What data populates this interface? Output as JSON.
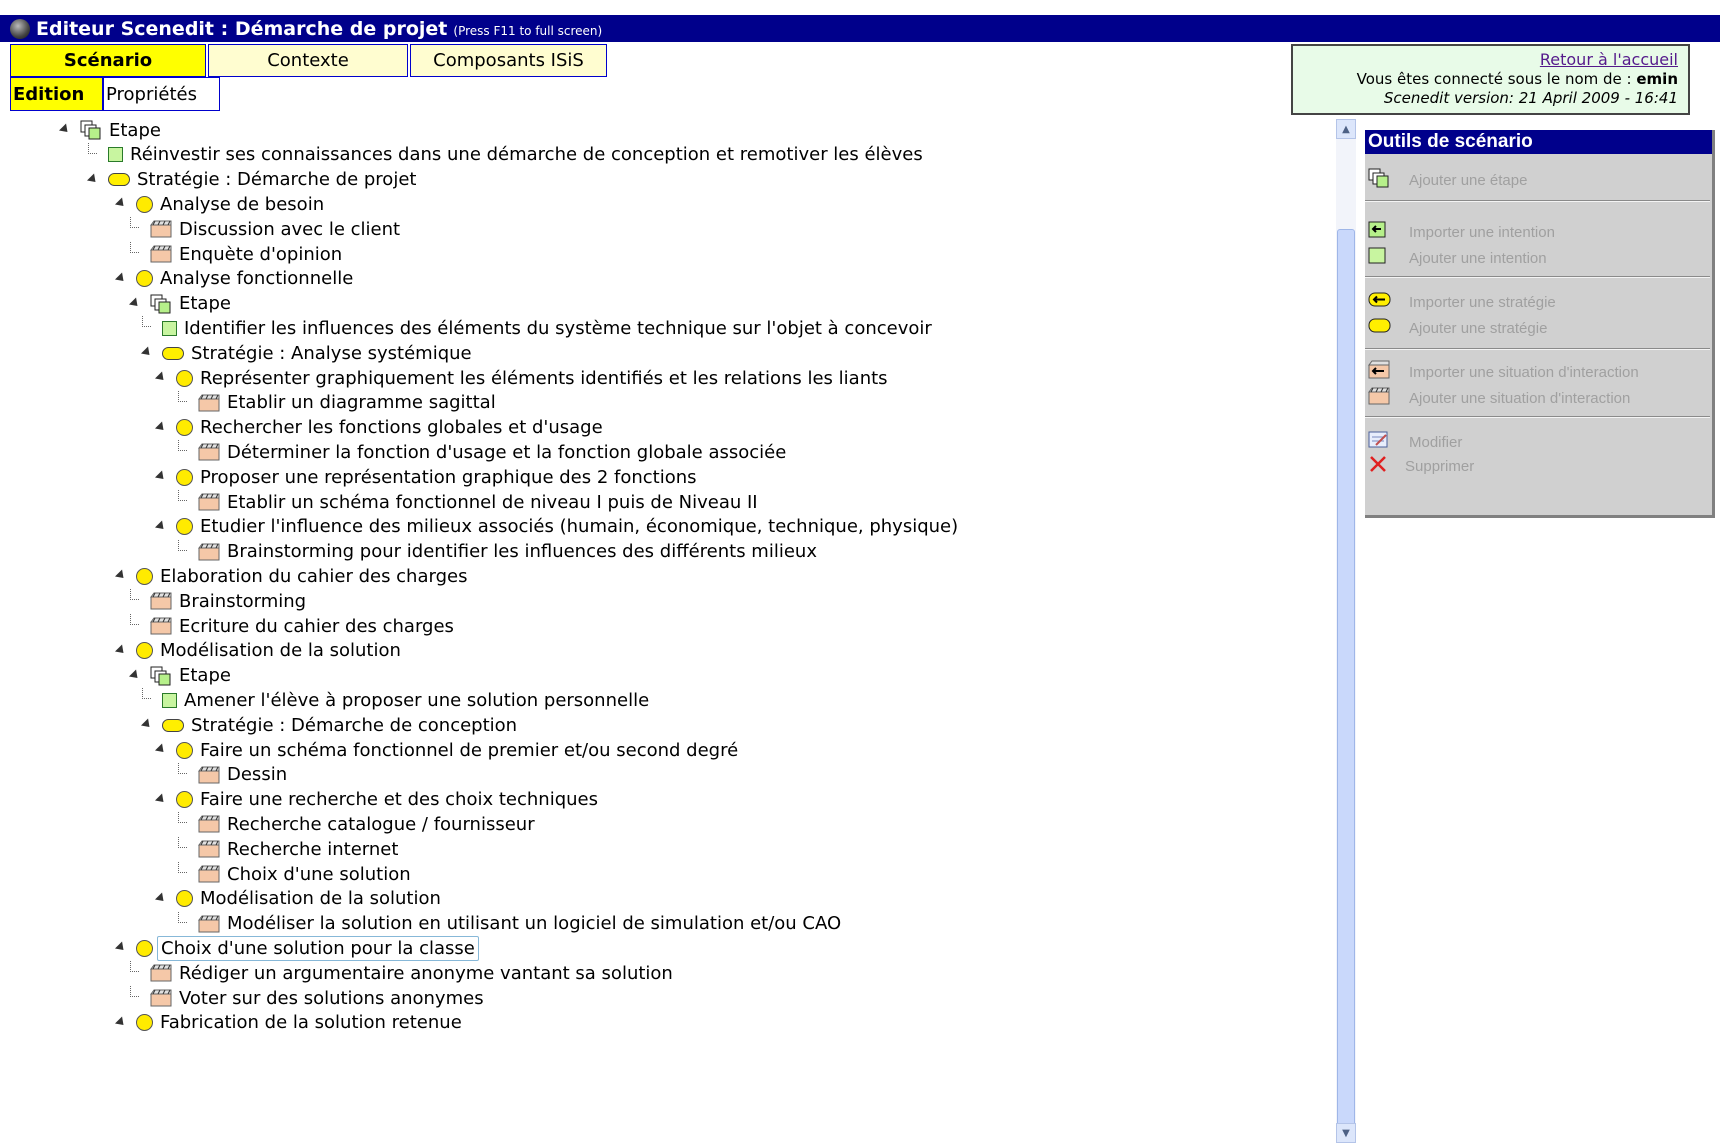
{
  "window": {
    "title": "Editeur Scenedit : Démarche de projet",
    "hint": "(Press F11 to full screen)"
  },
  "tabs": [
    {
      "label": "Scénario",
      "active": true
    },
    {
      "label": "Contexte",
      "active": false
    },
    {
      "label": "Composants ISiS",
      "active": false
    }
  ],
  "subtabs": [
    {
      "label": "Edition",
      "active": true
    },
    {
      "label": "Propriétés",
      "active": false
    }
  ],
  "info": {
    "home_link": "Retour à l'accueil",
    "connected_prefix": "Vous êtes connecté sous le nom de :",
    "username": "emin",
    "version": "Scenedit version: 21 April 2009 - 16:41"
  },
  "tree": [
    {
      "type": "etape",
      "label": "Etape"
    },
    {
      "type": "intention",
      "label": "Réinvestir ses connaissances dans une démarche de conception et remotiver les élèves"
    },
    {
      "type": "strategie",
      "label": "Stratégie : Démarche de projet"
    },
    {
      "type": "activite",
      "label": "Analyse de besoin"
    },
    {
      "type": "situation",
      "label": "Discussion avec le client"
    },
    {
      "type": "situation",
      "label": "Enquète d'opinion"
    },
    {
      "type": "activite",
      "label": "Analyse fonctionnelle"
    },
    {
      "type": "etape",
      "label": "Etape"
    },
    {
      "type": "intention",
      "label": "Identifier les influences des éléments du système technique sur l'objet à concevoir"
    },
    {
      "type": "strategie",
      "label": "Stratégie : Analyse systémique"
    },
    {
      "type": "activite",
      "label": "Représenter graphiquement les éléments identifiés et les relations les liants"
    },
    {
      "type": "situation",
      "label": "Etablir un diagramme sagittal"
    },
    {
      "type": "activite",
      "label": "Rechercher les fonctions globales et d'usage"
    },
    {
      "type": "situation",
      "label": "Déterminer la fonction d'usage et la fonction globale associée"
    },
    {
      "type": "activite",
      "label": "Proposer une représentation graphique des 2 fonctions"
    },
    {
      "type": "situation",
      "label": "Etablir un schéma fonctionnel de niveau I puis de Niveau II"
    },
    {
      "type": "activite",
      "label": "Etudier l'influence des milieux associés (humain, économique, technique, physique)"
    },
    {
      "type": "situation",
      "label": "Brainstorming pour identifier les influences des différents milieux"
    },
    {
      "type": "activite",
      "label": "Elaboration du cahier des charges"
    },
    {
      "type": "situation",
      "label": "Brainstorming"
    },
    {
      "type": "situation",
      "label": "Ecriture du cahier des charges"
    },
    {
      "type": "activite",
      "label": "Modélisation de la solution"
    },
    {
      "type": "etape",
      "label": "Etape"
    },
    {
      "type": "intention",
      "label": "Amener l'élève à proposer une solution personnelle"
    },
    {
      "type": "strategie",
      "label": "Stratégie : Démarche de conception"
    },
    {
      "type": "activite",
      "label": "Faire un schéma fonctionnel de premier et/ou second degré"
    },
    {
      "type": "situation",
      "label": "Dessin"
    },
    {
      "type": "activite",
      "label": "Faire une recherche et des choix techniques"
    },
    {
      "type": "situation",
      "label": "Recherche catalogue / fournisseur"
    },
    {
      "type": "situation",
      "label": "Recherche internet"
    },
    {
      "type": "situation",
      "label": "Choix d'une solution"
    },
    {
      "type": "activite",
      "label": "Modélisation de la solution"
    },
    {
      "type": "situation",
      "label": "Modéliser la solution en utilisant un logiciel de simulation et/ou CAO"
    },
    {
      "type": "activite",
      "label": "Choix d'une solution pour la classe",
      "selected": true
    },
    {
      "type": "situation",
      "label": "Rédiger un argumentaire anonyme vantant sa solution"
    },
    {
      "type": "situation",
      "label": "Voter sur des solutions anonymes"
    },
    {
      "type": "activite",
      "label": "Fabrication de la solution retenue"
    }
  ],
  "tools": {
    "title": "Outils de scénario",
    "items": [
      {
        "label": "Ajouter une étape",
        "icon": "add-step-icon"
      },
      {
        "label": "Importer une intention",
        "icon": "import-intention-icon"
      },
      {
        "label": "Ajouter une intention",
        "icon": "add-intention-icon"
      },
      {
        "label": "Importer une stratégie",
        "icon": "import-strategy-icon"
      },
      {
        "label": "Ajouter une stratégie",
        "icon": "add-strategy-icon"
      },
      {
        "label": "Importer une situation d'interaction",
        "icon": "import-situation-icon"
      },
      {
        "label": "Ajouter une situation d'interaction",
        "icon": "add-situation-icon"
      },
      {
        "label": "Modifier",
        "icon": "edit-icon"
      },
      {
        "label": "Supprimer",
        "icon": "delete-icon"
      }
    ]
  },
  "colors": {
    "titlebar": "#00008b",
    "tab_active": "#ffff00",
    "tab_inactive": "#fffdd0",
    "intention": "#c8f5a0",
    "activity": "#ffeb00",
    "situation": "#f5c8a8"
  }
}
